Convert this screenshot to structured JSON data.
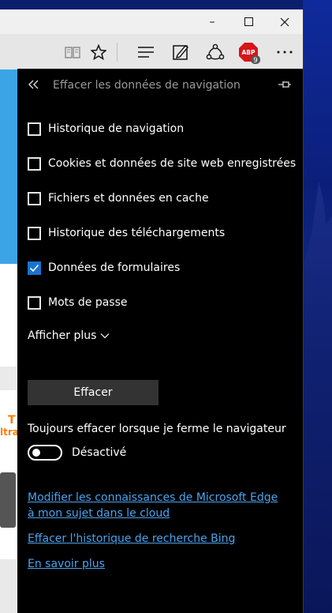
{
  "window": {
    "controls": {
      "minimize": "–",
      "maximize": "☐",
      "close": "✕"
    }
  },
  "toolbar": {
    "icons": [
      "reading-view-icon",
      "favorite-star-icon",
      "hub-icon",
      "web-note-icon",
      "share-icon",
      "adblock-icon",
      "more-icon"
    ],
    "abp": {
      "label": "ABP",
      "badge": "9"
    }
  },
  "panel": {
    "title": "Effacer les données de navigation",
    "options": [
      {
        "label": "Historique de navigation",
        "checked": false
      },
      {
        "label": "Cookies et données de site web enregistrées",
        "checked": false
      },
      {
        "label": "Fichiers et données en cache",
        "checked": false
      },
      {
        "label": "Historique des téléchargements",
        "checked": false
      },
      {
        "label": "Données de formulaires",
        "checked": true
      },
      {
        "label": "Mots de passe",
        "checked": false
      }
    ],
    "show_more": "Afficher plus",
    "clear_button": "Effacer",
    "always_clear": "Toujours effacer lorsque je ferme le navigateur",
    "toggle_state": "Désactivé",
    "links": [
      "Modifier les connaissances de Microsoft Edge à mon sujet dans le cloud",
      "Effacer l'historique de recherche Bing",
      "En savoir plus"
    ]
  },
  "page_sliver": {
    "promo_text_1": "T",
    "promo_text_2": "ltra"
  },
  "colors": {
    "panel_bg": "#000000",
    "accent": "#1a73d1",
    "link": "#4aa3f0",
    "abp_red": "#d7141a"
  }
}
